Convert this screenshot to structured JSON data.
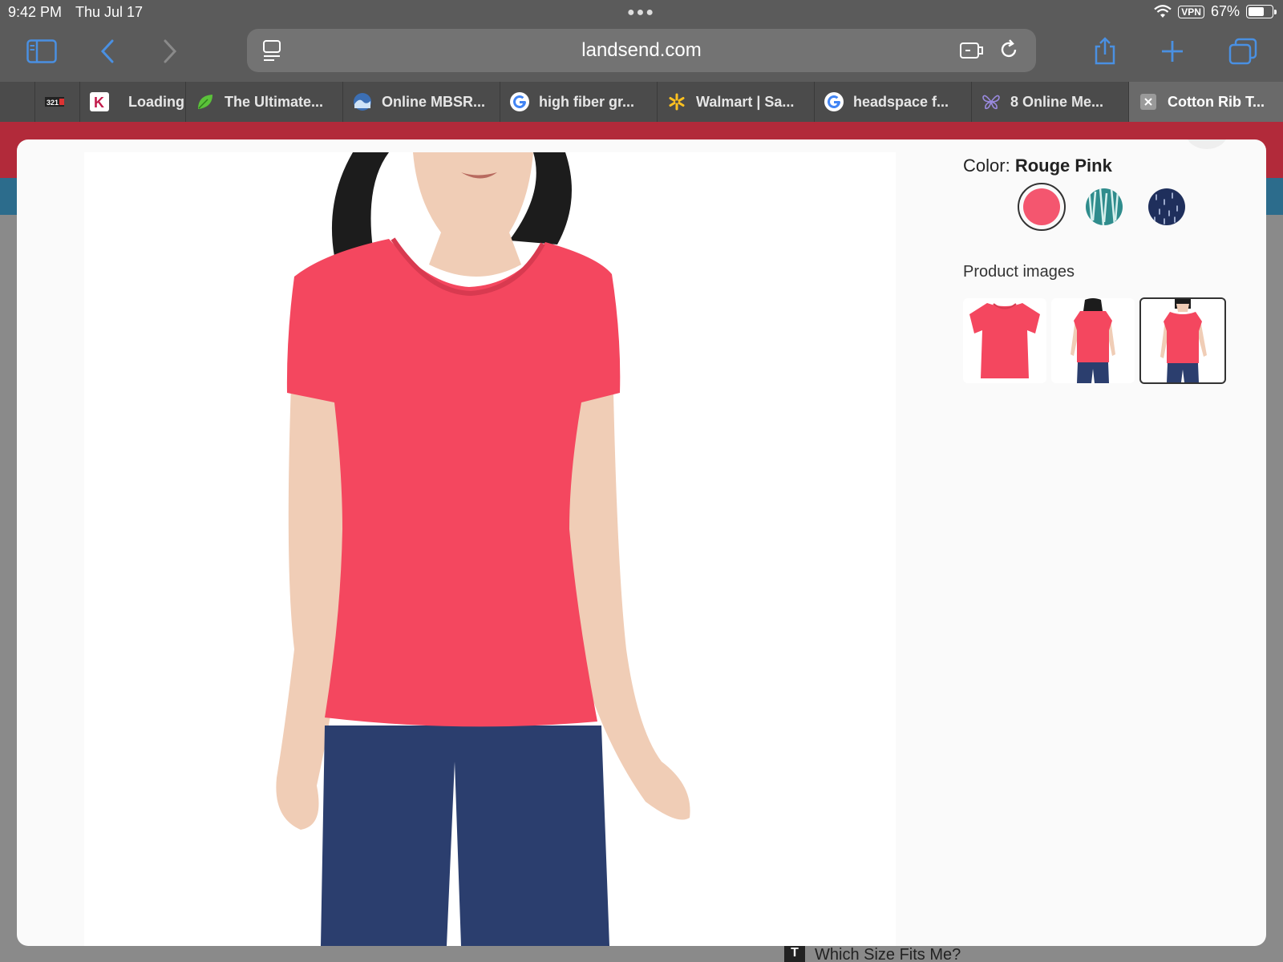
{
  "status_bar": {
    "time": "9:42 PM",
    "date": "Thu Jul 17",
    "vpn": "VPN",
    "battery": "67%",
    "battery_level": 0.67
  },
  "browser": {
    "url": "landsend.com",
    "tabs": [
      {
        "label": "",
        "icon": "site-logo-icon",
        "active": false
      },
      {
        "label": "Loading",
        "icon": "k-logo-icon",
        "active": false
      },
      {
        "label": "The Ultimate...",
        "icon": "leaf-icon",
        "active": false
      },
      {
        "label": "Online MBSR...",
        "icon": "wave-icon",
        "active": false
      },
      {
        "label": "high fiber gr...",
        "icon": "google-icon",
        "active": false
      },
      {
        "label": "Walmart | Sa...",
        "icon": "walmart-spark-icon",
        "active": false
      },
      {
        "label": "headspace f...",
        "icon": "google-icon",
        "active": false
      },
      {
        "label": "8 Online Me...",
        "icon": "butterfly-icon",
        "active": false
      },
      {
        "label": "Cotton Rib T...",
        "icon": "close-icon",
        "active": true
      }
    ]
  },
  "product_modal": {
    "color_label": "Color:",
    "color_value": "Rouge Pink",
    "swatches": [
      {
        "name": "Rouge Pink",
        "color": "#f4566f",
        "selected": true
      },
      {
        "name": "teal pattern",
        "color": "#2f8c8c",
        "selected": false
      },
      {
        "name": "navy pattern",
        "color": "#1f2f5c",
        "selected": false
      }
    ],
    "product_images_label": "Product images",
    "thumbnails": [
      {
        "view": "shirt-flat",
        "selected": false
      },
      {
        "view": "model-back",
        "selected": false
      },
      {
        "view": "model-front",
        "selected": true
      }
    ]
  },
  "background_page": {
    "size_link": "Which Size Fits Me?"
  },
  "colors": {
    "shirt": "#f4475f",
    "jeans": "#2b3e6e",
    "skin": "#f0cdb6",
    "hair": "#1c1c1c"
  }
}
